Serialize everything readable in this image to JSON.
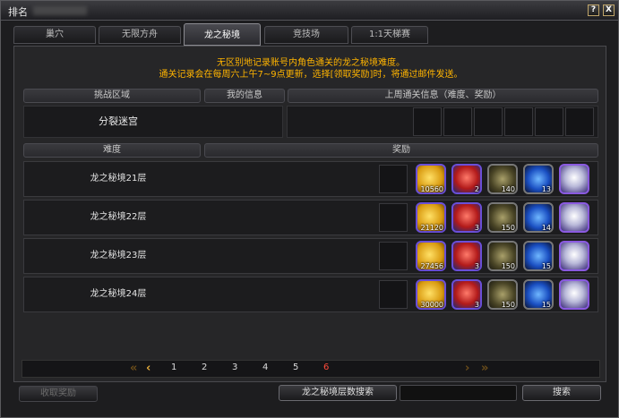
{
  "window": {
    "title": "排名",
    "help_label": "?",
    "close_label": "X"
  },
  "tabs": [
    {
      "label": "巢穴"
    },
    {
      "label": "无限方舟"
    },
    {
      "label": "龙之秘境"
    },
    {
      "label": "竞技场"
    },
    {
      "label": "1:1天梯赛"
    }
  ],
  "notice": {
    "line1": "无区别地记录账号内角色通关的龙之秘境难度。",
    "line2": "通关记录会在每周六上午7~9点更新，选择[领取奖励]时，将通过邮件发送。"
  },
  "info_headers": {
    "zone": "挑战区域",
    "my_info": "我的信息",
    "last_week": "上周通关信息（难度、奖励）"
  },
  "zone_value": "分裂迷宫",
  "list_headers": {
    "difficulty": "难度",
    "reward": "奖励"
  },
  "rows": [
    {
      "label": "龙之秘境21层",
      "counts": [
        "10560",
        "2",
        "140",
        "13",
        ""
      ]
    },
    {
      "label": "龙之秘境22层",
      "counts": [
        "21120",
        "3",
        "150",
        "14",
        ""
      ]
    },
    {
      "label": "龙之秘境23层",
      "counts": [
        "27456",
        "3",
        "150",
        "15",
        ""
      ]
    },
    {
      "label": "龙之秘境24层",
      "counts": [
        "30000",
        "3",
        "150",
        "15",
        ""
      ]
    }
  ],
  "reward_icons": [
    "gold-coin-icon",
    "red-orb-icon",
    "armor-material-icon",
    "blue-crystal-icon",
    "white-feather-icon"
  ],
  "pagination": {
    "pages": [
      "1",
      "2",
      "3",
      "4",
      "5",
      "6"
    ],
    "current": "6",
    "first": "«",
    "prev": "‹",
    "next": "›",
    "last": "»"
  },
  "buttons": {
    "claim": "收取奖励",
    "floor_search": "龙之秘境层数搜索",
    "search": "搜索"
  },
  "colors": {
    "notice": "#ffb400",
    "current_page": "#ff4a3a",
    "item_border": "#6a4fd8"
  }
}
